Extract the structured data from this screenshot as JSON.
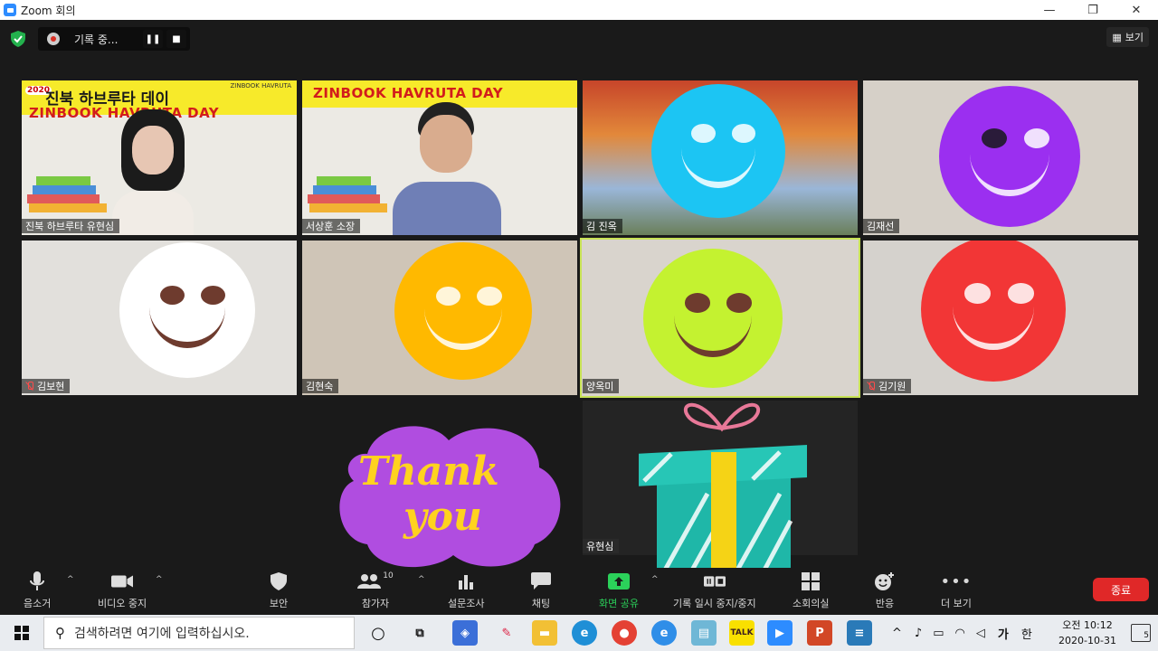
{
  "window": {
    "title": "Zoom 회의",
    "minimize": "—",
    "maximize": "❐",
    "close": "✕"
  },
  "recording": {
    "status": "기록 중..."
  },
  "view_button": {
    "label": "보기"
  },
  "banner": {
    "year": "2020",
    "brand": "ZINBOOK HAVRUTA",
    "title_ko": "진북 하브루타 데이",
    "title_en": "ZINBOOK HAVRUTA DAY"
  },
  "participants": [
    {
      "name": "진북 하브루타 유현심",
      "muted": false
    },
    {
      "name": "서상훈 소장",
      "muted": false
    },
    {
      "name": "김 진옥",
      "muted": false
    },
    {
      "name": "김재선",
      "muted": false
    },
    {
      "name": "김보현",
      "muted": true
    },
    {
      "name": "김현숙",
      "muted": false
    },
    {
      "name": "양옥미",
      "muted": false,
      "active": true
    },
    {
      "name": "김기원",
      "muted": true
    },
    {
      "name": "유현심",
      "muted": false
    }
  ],
  "stickers": {
    "thank_line1": "Thank",
    "thank_line2": "you"
  },
  "toolbar": {
    "mute": "음소거",
    "video": "비디오 중지",
    "security": "보안",
    "participants": "참가자",
    "participant_count": "10",
    "polls": "설문조사",
    "chat": "채팅",
    "share": "화면 공유",
    "record": "기록 일시 중지/중지",
    "breakout": "소회의실",
    "reactions": "반응",
    "more": "더 보기",
    "end": "종료"
  },
  "taskbar": {
    "search_placeholder": "검색하려면 여기에 입력하십시오.",
    "ime_lang": "가",
    "ime_mode": "한",
    "time": "오전 10:12",
    "date": "2020-10-31",
    "notification_count": "5"
  },
  "colors": {
    "smiley_cyan": "#1cc5f3",
    "smiley_purple": "#9b2ff0",
    "smiley_white": "#ffffff",
    "smiley_orange": "#ffb900",
    "smiley_lime": "#c4f230",
    "smiley_red": "#f23636",
    "active_speaker": "#c7e255",
    "end_button": "#e02828"
  }
}
